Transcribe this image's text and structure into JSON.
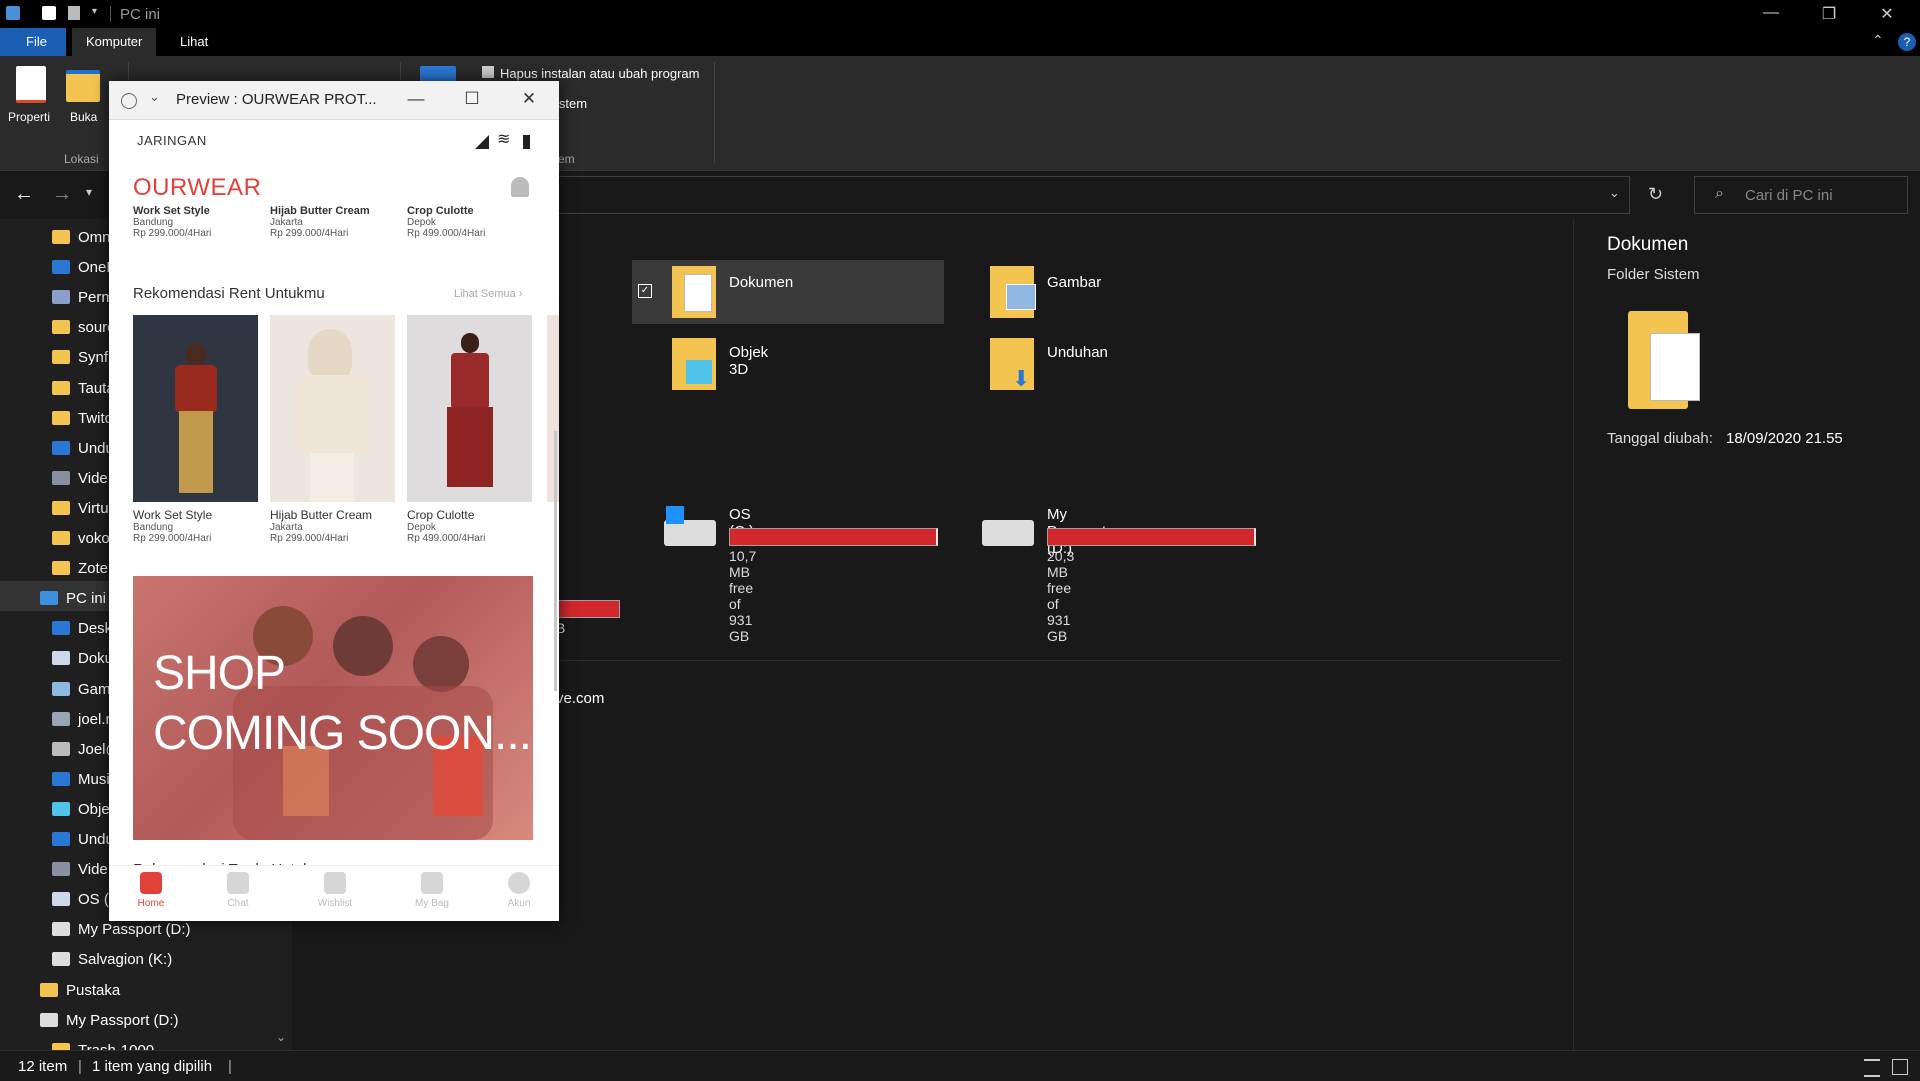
{
  "titlebar": {
    "title": "PC ini",
    "minimize": "—",
    "maximize": "❐",
    "close": "✕"
  },
  "ribbon_tabs": [
    "File",
    "Komputer",
    "Lihat"
  ],
  "ribbon": {
    "properti": "Properti",
    "buka": "Buka",
    "lokasi": "Lokasi",
    "hapus_instalan": "Hapus instalan atau ubah program",
    "istem": "istem",
    "em": "em",
    "help": "?"
  },
  "search": {
    "placeholder": "Cari di PC ini"
  },
  "nav": {
    "items": [
      "Omn",
      "OneD",
      "Perm",
      "sourc",
      "Synfi",
      "Tauta",
      "Twitc",
      "Undu",
      "Vide",
      "Virtu",
      "voko",
      "Zoter",
      "PC ini",
      "Desk",
      "Doku",
      "Gamb",
      "joel.r",
      "Joel@",
      "Musi",
      "Obje",
      "Undu",
      "Vide",
      "OS (C",
      "My Passport (D:)",
      "Salvagion (K:)",
      "Pustaka",
      "My Passport (D:)",
      "Trash-1000"
    ]
  },
  "folders": [
    {
      "name": "Dokumen",
      "icon": "documents-folder-icon",
      "selected": true
    },
    {
      "name": "Gambar",
      "icon": "pictures-folder-icon"
    },
    {
      "name": "Objek 3D",
      "icon": "3d-objects-folder-icon"
    },
    {
      "name": "Unduhan",
      "icon": "downloads-folder-icon"
    }
  ],
  "drives": [
    {
      "name": "OS (C:)",
      "free": "10,7 MB free of 931 GB",
      "used_fraction": 0.99
    },
    {
      "name": "My Passport (D:)",
      "free": "20,3 MB free of 931 GB",
      "used_fraction": 0.99
    }
  ],
  "network_fragment": "ve.com",
  "drive_fragment": "B",
  "details": {
    "title": "Dokumen",
    "subtitle": "Folder Sistem",
    "modified_label": "Tanggal diubah:",
    "modified_value": "18/09/2020 21.55"
  },
  "status": {
    "count": "12 item",
    "selected": "1 item yang dipilih",
    "sep": "|"
  },
  "preview": {
    "title": "Preview : OURWEAR PROT...",
    "status_text": "JARINGAN",
    "brand": "OURWEAR",
    "top_row": [
      {
        "name": "Work Set Style",
        "city": "Bandung",
        "price": "Rp 299.000/4Hari"
      },
      {
        "name": "Hijab Butter Cream",
        "city": "Jakarta",
        "price": "Rp 299.000/4Hari"
      },
      {
        "name": "Crop Culotte",
        "city": "Depok",
        "price": "Rp 499.000/4Hari"
      }
    ],
    "section_rent": "Rekomendasi Rent Untukmu",
    "see_all": "Lihat Semua ›",
    "products": [
      {
        "name": "Work Set Style",
        "city": "Bandung",
        "price": "Rp 299.000/4Hari"
      },
      {
        "name": "Hijab Butter Cream",
        "city": "Jakarta",
        "price": "Rp 299.000/4Hari"
      },
      {
        "name": "Crop Culotte",
        "city": "Depok",
        "price": "Rp 499.000/4Hari"
      }
    ],
    "banner_line1": "SHOP",
    "banner_line2": "COMING SOON...",
    "section_trade": "Rekomendasi Trade Untukmu",
    "tabs": [
      "Home",
      "Chat",
      "Wishlist",
      "My Bag",
      "Akun"
    ]
  },
  "colors": {
    "accent": "#1a5fb4",
    "brand": "#e2423a",
    "drive_bar": "#d2272c",
    "folder": "#f3c44f"
  }
}
